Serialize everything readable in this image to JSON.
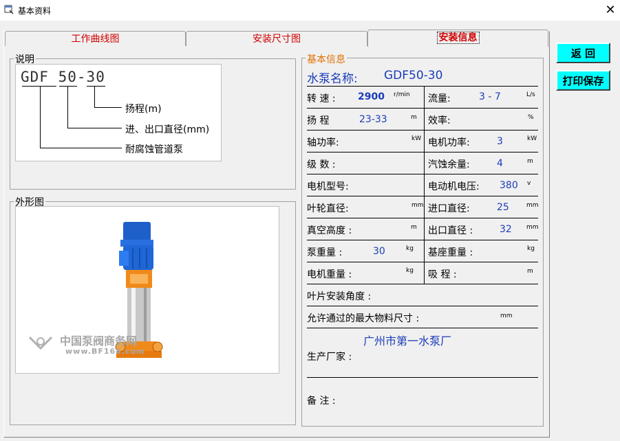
{
  "window": {
    "title": "基本资料",
    "close_glyph": "✕"
  },
  "tabs": [
    {
      "label": "工作曲线图"
    },
    {
      "label": "安装尺寸图"
    },
    {
      "label": "安装信息"
    }
  ],
  "legend": {
    "group_label": "说明",
    "code_prefix": "GDF",
    "code_size": "50",
    "code_dash": "-",
    "code_head": "30",
    "line1": "扬程(m)",
    "line2": "进、出口直径(mm)",
    "line3": "耐腐蚀管道泵"
  },
  "photo": {
    "group_label": "外形图",
    "watermark_cn": "中国泵阀商务网",
    "watermark_url": "www.BF168.com"
  },
  "info": {
    "group_label": "基本信息",
    "pump_name_label": "水泵名称:",
    "pump_name_value": "GDF50-30",
    "speed_label": "转 速 :",
    "speed_value": "2900",
    "speed_unit": "r/min",
    "flow_label": "流量:",
    "flow_value": "3 - 7",
    "flow_unit": "L/s",
    "head_label": "扬 程",
    "head_value": "23-33",
    "head_unit": "m",
    "eff_label": "效率:",
    "eff_unit": "%",
    "shaft_label": "轴功率:",
    "shaft_unit": "kW",
    "motor_power_label": "电机功率:",
    "motor_power_value": "3",
    "motor_power_unit": "kW",
    "stage_label": "级 数 :",
    "npsh_label": "汽蚀余量:",
    "npsh_value": "4",
    "npsh_unit": "m",
    "motor_model_label": "电机型号:",
    "motor_voltage_label": "电动机电压:",
    "motor_voltage_value": "380",
    "motor_voltage_unit": "v",
    "impeller_label": "叶轮直径:",
    "impeller_unit": "mm",
    "inlet_label": "进口直径:",
    "inlet_value": "25",
    "inlet_unit": "mm",
    "vacuum_label": "真空高度 :",
    "vacuum_unit": "m",
    "outlet_label": "出口直径 :",
    "outlet_value": "32",
    "outlet_unit": "mm",
    "pump_weight_label": "泵重量 :",
    "pump_weight_value": "30",
    "pump_weight_unit": "kg",
    "base_weight_label": "基座重量 :",
    "base_weight_unit": "kg",
    "motor_weight_label": "电机重量 :",
    "motor_weight_unit": "kg",
    "suction_label": "吸 程 :",
    "suction_unit": "m",
    "blade_angle_label": "叶片安装角度 :",
    "max_particle_label": "允许通过的最大物料尺寸 :",
    "max_particle_unit": "mm",
    "maker_value": "广州市第一水泵厂",
    "maker_label": "生产厂家 :",
    "remark_label": "备 注 :"
  },
  "buttons": {
    "back": "返 回",
    "print_save": "打印保存"
  },
  "colors": {
    "tab_text": "#d00000",
    "value_blue": "#1a3cb8",
    "group_orange": "#e07000",
    "button_cyan": "#00ffff"
  }
}
